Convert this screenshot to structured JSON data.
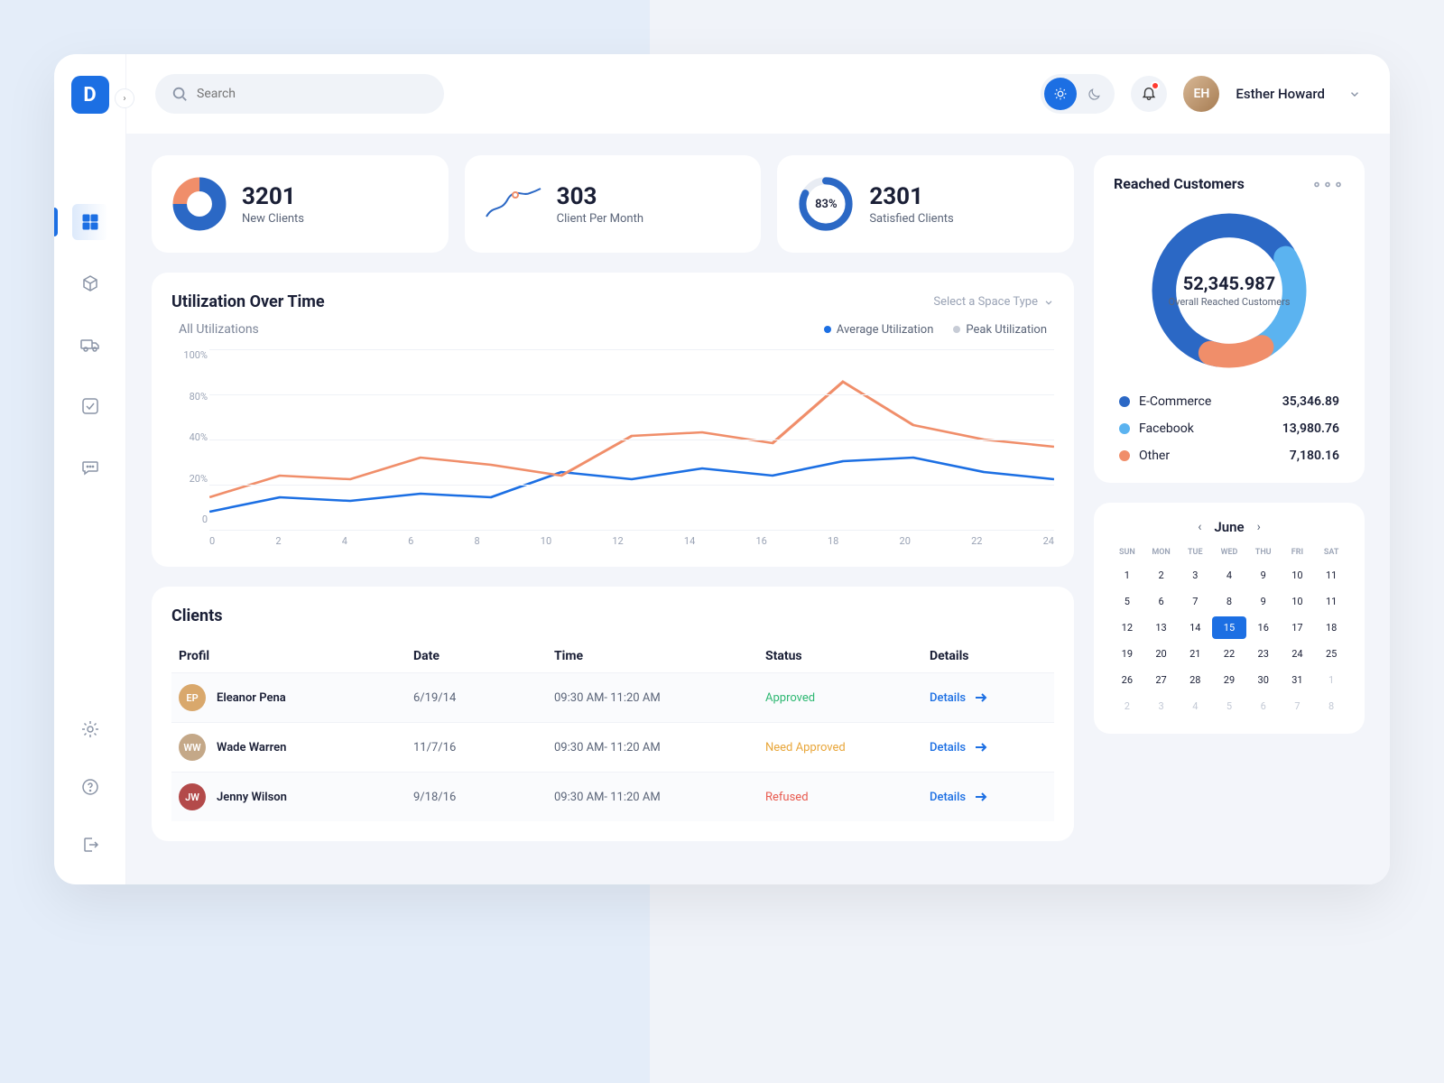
{
  "user": {
    "name": "Esther Howard"
  },
  "search": {
    "placeholder": "Search"
  },
  "stats": {
    "new_clients": {
      "value": "3201",
      "label": "New Clients"
    },
    "per_month": {
      "value": "303",
      "label": "Client Per Month"
    },
    "satisfied": {
      "value": "2301",
      "label": "Satisfied Clients",
      "pct": "83%"
    }
  },
  "utilization": {
    "title": "Utilization Over Time",
    "selector": "Select a Space Type",
    "subtitle": "All Utilizations",
    "legend1": "Average Utilization",
    "legend2": "Peak Utilization"
  },
  "reached": {
    "title": "Reached Customers",
    "center_value": "52,345.987",
    "center_label": "Overall Reached Customers",
    "items": [
      {
        "label": "E-Commerce",
        "value": "35,346.89",
        "color": "#2b68c5"
      },
      {
        "label": "Facebook",
        "value": "13,980.76",
        "color": "#5bb3f0"
      },
      {
        "label": "Other",
        "value": "7,180.16",
        "color": "#f08e6a"
      }
    ]
  },
  "clients": {
    "title": "Clients",
    "cols": {
      "profile": "Profil",
      "date": "Date",
      "time": "Time",
      "status": "Status",
      "details": "Details"
    },
    "details_label": "Details",
    "rows": [
      {
        "name": "Eleanor Pena",
        "date": "6/19/14",
        "time": "09:30 AM- 11:20 AM",
        "status": "Approved",
        "status_cls": "status-approved",
        "av": "#d9a86c"
      },
      {
        "name": "Wade Warren",
        "date": "11/7/16",
        "time": "09:30 AM- 11:20 AM",
        "status": "Need Approved",
        "status_cls": "status-need",
        "av": "#c4a888"
      },
      {
        "name": "Jenny Wilson",
        "date": "9/18/16",
        "time": "09:30 AM- 11:20 AM",
        "status": "Refused",
        "status_cls": "status-refused",
        "av": "#b34a4a"
      }
    ]
  },
  "calendar": {
    "month": "June",
    "dows": [
      "SUN",
      "MON",
      "TUE",
      "WED",
      "THU",
      "FRI",
      "SAT"
    ],
    "days": [
      {
        "n": "1"
      },
      {
        "n": "2"
      },
      {
        "n": "3"
      },
      {
        "n": "4"
      },
      {
        "n": "9"
      },
      {
        "n": "10"
      },
      {
        "n": "11"
      },
      {
        "n": "5"
      },
      {
        "n": "6"
      },
      {
        "n": "7"
      },
      {
        "n": "8"
      },
      {
        "n": "9"
      },
      {
        "n": "10"
      },
      {
        "n": "11"
      },
      {
        "n": "12"
      },
      {
        "n": "13"
      },
      {
        "n": "14"
      },
      {
        "n": "15",
        "sel": true
      },
      {
        "n": "16"
      },
      {
        "n": "17"
      },
      {
        "n": "18"
      },
      {
        "n": "19"
      },
      {
        "n": "20"
      },
      {
        "n": "21"
      },
      {
        "n": "22"
      },
      {
        "n": "23"
      },
      {
        "n": "24"
      },
      {
        "n": "25"
      },
      {
        "n": "26"
      },
      {
        "n": "27"
      },
      {
        "n": "28"
      },
      {
        "n": "29"
      },
      {
        "n": "30"
      },
      {
        "n": "31"
      },
      {
        "n": "1",
        "dim": true
      },
      {
        "n": "2",
        "dim": true
      },
      {
        "n": "3",
        "dim": true
      },
      {
        "n": "4",
        "dim": true
      },
      {
        "n": "5",
        "dim": true
      },
      {
        "n": "6",
        "dim": true
      },
      {
        "n": "7",
        "dim": true
      },
      {
        "n": "8",
        "dim": true
      }
    ]
  },
  "chart_data": [
    {
      "type": "line",
      "title": "Utilization Over Time",
      "xlabel": "",
      "ylabel": "",
      "ylim": [
        0,
        100
      ],
      "x": [
        0,
        2,
        4,
        6,
        8,
        10,
        12,
        14,
        16,
        18,
        20,
        22,
        24
      ],
      "y_ticks": [
        "0",
        "20%",
        "40%",
        "80%",
        "100%"
      ],
      "series": [
        {
          "name": "Average Utilization",
          "color": "#1c6fe3",
          "values": [
            10,
            18,
            16,
            20,
            18,
            32,
            28,
            34,
            30,
            38,
            40,
            32,
            28
          ]
        },
        {
          "name": "Peak Utilization",
          "color": "#f08e6a",
          "values": [
            18,
            30,
            28,
            40,
            36,
            30,
            52,
            54,
            48,
            82,
            58,
            50,
            46
          ]
        }
      ]
    },
    {
      "type": "pie",
      "title": "Reached Customers",
      "series": [
        {
          "name": "E-Commerce",
          "value": 35346.89
        },
        {
          "name": "Facebook",
          "value": 13980.76
        },
        {
          "name": "Other",
          "value": 7180.16
        }
      ]
    }
  ]
}
